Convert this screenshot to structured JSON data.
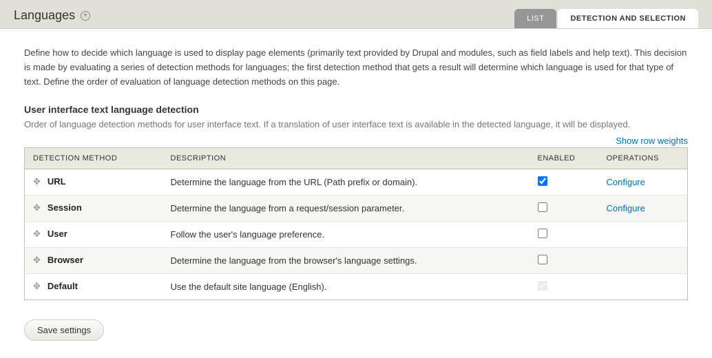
{
  "header": {
    "title": "Languages",
    "tabs": {
      "list": "LIST",
      "detection": "DETECTION AND SELECTION"
    }
  },
  "intro": "Define how to decide which language is used to display page elements (primarily text provided by Drupal and modules, such as field labels and help text). This decision is made by evaluating a series of detection methods for languages; the first detection method that gets a result will determine which language is used for that type of text. Define the order of evaluation of language detection methods on this page.",
  "section": {
    "title": "User interface text language detection",
    "desc": "Order of language detection methods for user interface text. If a translation of user interface text is available in the detected language, it will be displayed."
  },
  "show_weights": "Show row weights",
  "table": {
    "headers": {
      "method": "DETECTION METHOD",
      "description": "DESCRIPTION",
      "enabled": "ENABLED",
      "operations": "OPERATIONS"
    },
    "rows": [
      {
        "method": "URL",
        "description": "Determine the language from the URL (Path prefix or domain).",
        "enabled": true,
        "disabled": false,
        "op": "Configure"
      },
      {
        "method": "Session",
        "description": "Determine the language from a request/session parameter.",
        "enabled": false,
        "disabled": false,
        "op": "Configure"
      },
      {
        "method": "User",
        "description": "Follow the user's language preference.",
        "enabled": false,
        "disabled": false,
        "op": ""
      },
      {
        "method": "Browser",
        "description": "Determine the language from the browser's language settings.",
        "enabled": false,
        "disabled": false,
        "op": ""
      },
      {
        "method": "Default",
        "description": "Use the default site language (English).",
        "enabled": true,
        "disabled": true,
        "op": ""
      }
    ]
  },
  "save_label": "Save settings"
}
